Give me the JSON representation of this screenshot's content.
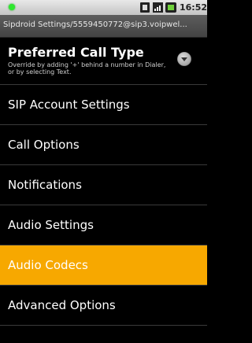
{
  "status_bar": {
    "time": "16:52",
    "icons": [
      "notification-dot-icon",
      "sim-icon",
      "signal-icon",
      "battery-icon"
    ]
  },
  "title_bar": {
    "title": "Sipdroid Settings/5559450772@sip3.voipwel..."
  },
  "preferences": [
    {
      "label": "Preferred Call Type",
      "summary": "Override by adding '+' behind a number in Dialer, or by selecting Text.",
      "has_dropdown": true
    },
    {
      "label": "SIP Account Settings"
    },
    {
      "label": "Call Options"
    },
    {
      "label": "Notifications"
    },
    {
      "label": "Audio Settings"
    },
    {
      "label": "Audio Codecs",
      "highlighted": true
    },
    {
      "label": "Advanced Options"
    }
  ],
  "colors": {
    "highlight": "#f7a800",
    "background": "#000000",
    "status_bar": "#d6d6d6",
    "title_bar": "#4f4f4f"
  }
}
